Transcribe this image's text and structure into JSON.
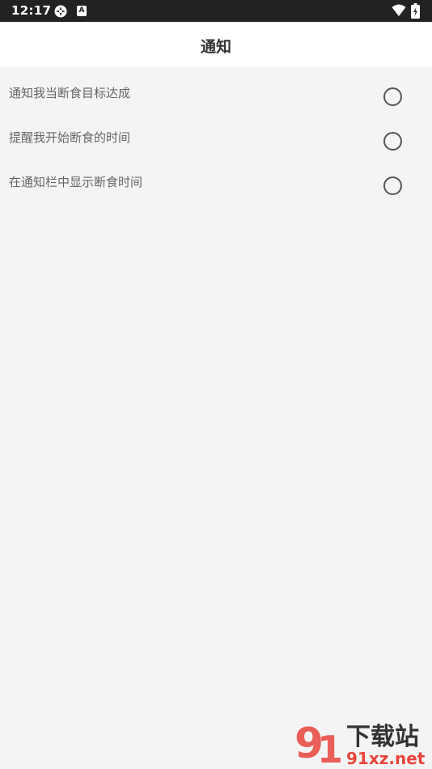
{
  "status_bar": {
    "time": "12:17",
    "icons": [
      "app-notification-icon",
      "a-badge-icon",
      "wifi-icon",
      "battery-charging-icon"
    ],
    "badge_letter": "A"
  },
  "header": {
    "title": "通知"
  },
  "settings": [
    {
      "label": "通知我当断食目标达成",
      "checked": false
    },
    {
      "label": "提醒我开始断食的时间",
      "checked": false
    },
    {
      "label": "在通知栏中显示断食时间",
      "checked": false
    }
  ],
  "watermark": {
    "logo_text": "下载站",
    "site": "91xz.net",
    "accent_color": "#e8453c"
  },
  "colors": {
    "status_bar": "#222222",
    "background": "#f4f4f4",
    "app_bar": "#ffffff",
    "label": "#666666",
    "radio_border": "#555555"
  }
}
